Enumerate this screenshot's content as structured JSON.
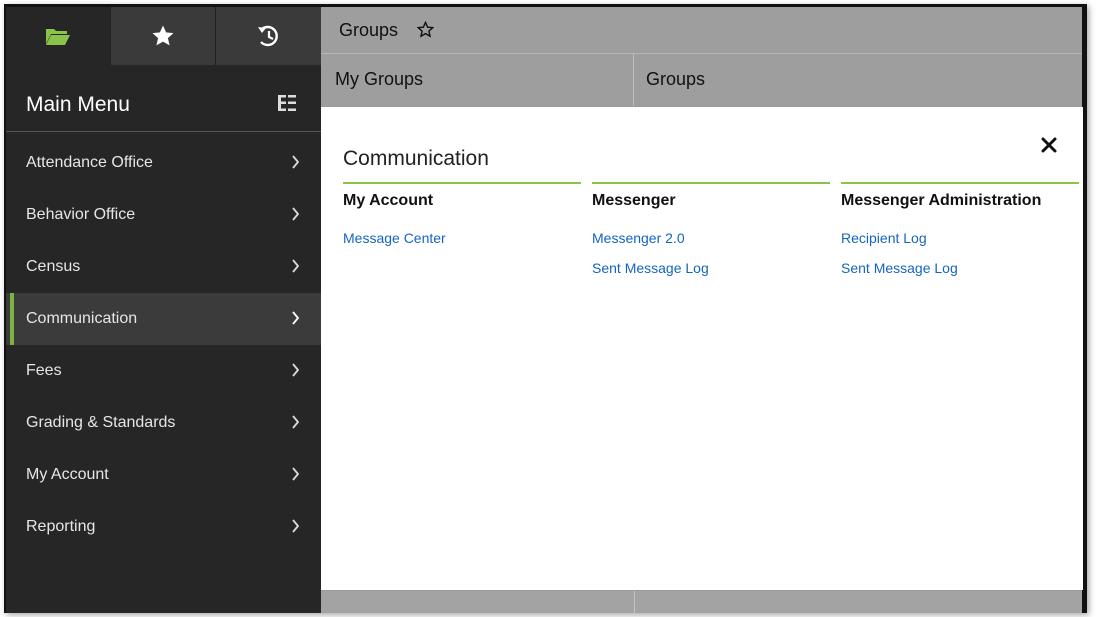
{
  "icons": {
    "folder": "folder-open-icon",
    "favorites": "star-icon",
    "history": "history-icon",
    "tree": "tree-menu-icon",
    "close": "close-icon"
  },
  "colors": {
    "accent": "#7cb342",
    "link": "#1565c0",
    "sidebar_bg": "#262626"
  },
  "sidebar": {
    "title": "Main Menu",
    "items": [
      {
        "label": "Attendance Office"
      },
      {
        "label": "Behavior Office"
      },
      {
        "label": "Census"
      },
      {
        "label": "Communication",
        "active": true
      },
      {
        "label": "Fees"
      },
      {
        "label": "Grading & Standards"
      },
      {
        "label": "My Account"
      },
      {
        "label": "Reporting"
      }
    ]
  },
  "background_page": {
    "title": "Groups",
    "left_column": "My Groups",
    "right_column": "Groups"
  },
  "panel": {
    "title": "Communication",
    "sections": [
      {
        "heading": "My Account",
        "links": [
          "Message Center"
        ]
      },
      {
        "heading": "Messenger",
        "links": [
          "Messenger 2.0",
          "Sent Message Log"
        ]
      },
      {
        "heading": "Messenger Administration",
        "links": [
          "Recipient Log",
          "Sent Message Log"
        ]
      }
    ]
  }
}
